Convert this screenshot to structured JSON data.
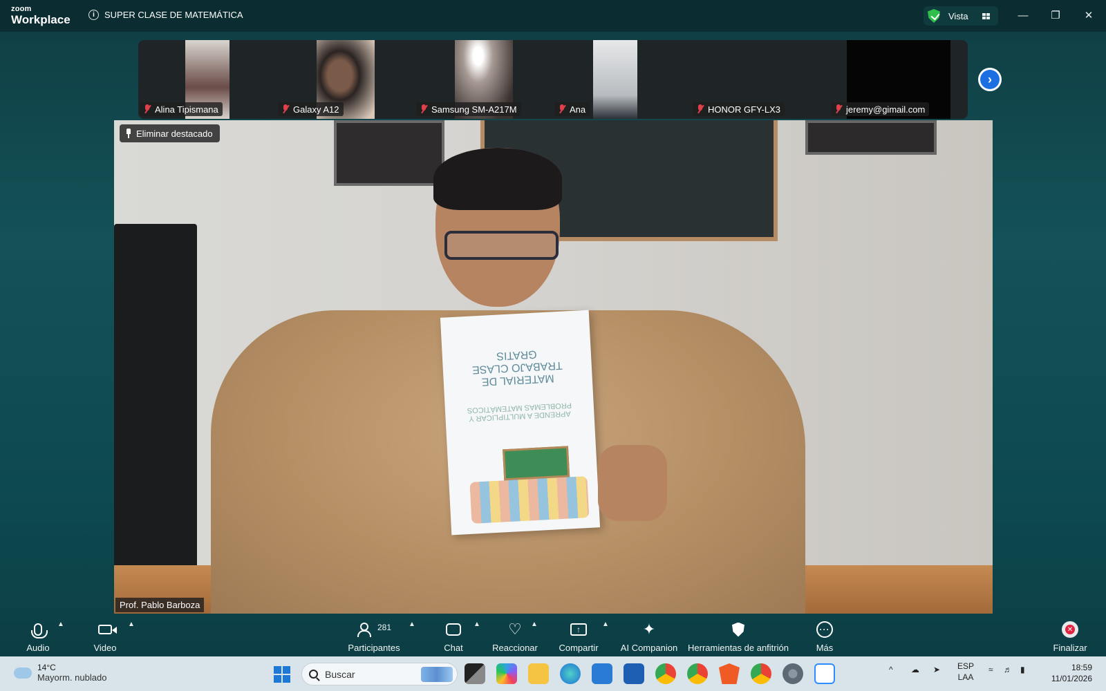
{
  "titlebar": {
    "logo_top": "zoom",
    "logo_bottom": "Workplace",
    "meeting_title": "SUPER CLASE DE MATEMÁTICA",
    "view_label": "Vista",
    "icons": [
      "info-icon",
      "security-shield-icon",
      "grid-icon",
      "minimize-icon",
      "restore-icon",
      "close-icon"
    ]
  },
  "participants_strip": [
    {
      "name": "Alina Tipismana",
      "muted": true
    },
    {
      "name": "Galaxy A12",
      "muted": true
    },
    {
      "name": "Samsung SM-A217M",
      "muted": true
    },
    {
      "name": "Ana",
      "muted": true
    },
    {
      "name": "HONOR GFY-LX3",
      "muted": true
    },
    {
      "name": "jeremy@gimail.com",
      "muted": true
    }
  ],
  "main_video": {
    "unpin_label": "Eliminar destacado",
    "speaker_name": "Prof. Pablo Barboza",
    "booklet_title": "MATERIAL DE TRABAJO CLASE GRATIS",
    "booklet_subtitle": "APRENDE A MULTIPLICAR Y PROBLEMAS MATEMÁTICOS"
  },
  "toolbar": {
    "audio": "Audio",
    "video": "Video",
    "participants": "Participantes",
    "participants_count": "281",
    "chat": "Chat",
    "react": "Reaccionar",
    "share": "Compartir",
    "ai": "AI Companion",
    "host_tools": "Herramientas de anfitrión",
    "more": "Más",
    "end": "Finalizar"
  },
  "taskbar": {
    "temperature": "14°C",
    "weather": "Mayorm. nublado",
    "search_placeholder": "Buscar",
    "lang_top": "ESP",
    "lang_bottom": "LAA",
    "time": "18:59",
    "date": "11/01/2026"
  },
  "colors": {
    "titlebar_bg": "#0b2d31",
    "background": "#135258",
    "muted_red": "#e0404a",
    "accent_blue": "#1b6fe0",
    "end_red": "#e0243f",
    "secure_green": "#2fbf4a"
  }
}
